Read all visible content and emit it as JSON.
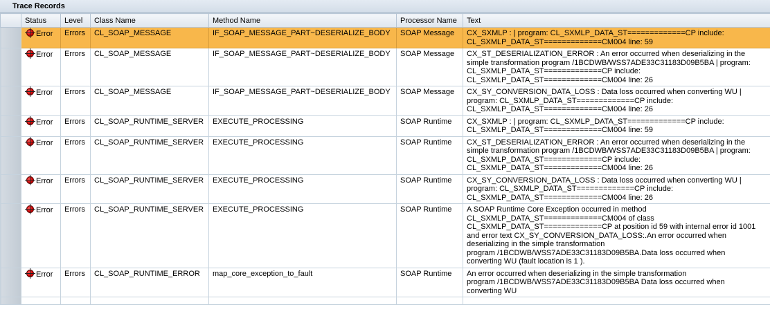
{
  "panel": {
    "title": "Trace Records"
  },
  "columns": {
    "status": "Status",
    "level": "Level",
    "class_name": "Class Name",
    "method_name": "Method Name",
    "processor_name": "Processor Name",
    "text": "Text"
  },
  "rows": [
    {
      "status": "Error",
      "level": "Errors",
      "class_name": "CL_SOAP_MESSAGE",
      "method_name": "IF_SOAP_MESSAGE_PART~DESERIALIZE_BODY",
      "processor_name": "SOAP Message",
      "text": "CX_SXMLP : | program: CL_SXMLP_DATA_ST=============CP include:\nCL_SXMLP_DATA_ST=============CM004 line: 59"
    },
    {
      "status": "Error",
      "level": "Errors",
      "class_name": "CL_SOAP_MESSAGE",
      "method_name": "IF_SOAP_MESSAGE_PART~DESERIALIZE_BODY",
      "processor_name": "SOAP Message",
      "text": "CX_ST_DESERIALIZATION_ERROR : An error occurred when deserializing in the\nsimple transformation program /1BCDWB/WSS7ADE33C31183D09B5BA | program:\nCL_SXMLP_DATA_ST=============CP include:\nCL_SXMLP_DATA_ST=============CM004 line: 26"
    },
    {
      "status": "Error",
      "level": "Errors",
      "class_name": "CL_SOAP_MESSAGE",
      "method_name": "IF_SOAP_MESSAGE_PART~DESERIALIZE_BODY",
      "processor_name": "SOAP Message",
      "text": "CX_SY_CONVERSION_DATA_LOSS : Data loss occurred when converting WU |\nprogram: CL_SXMLP_DATA_ST=============CP include:\nCL_SXMLP_DATA_ST=============CM004 line: 26"
    },
    {
      "status": "Error",
      "level": "Errors",
      "class_name": "CL_SOAP_RUNTIME_SERVER",
      "method_name": "EXECUTE_PROCESSING",
      "processor_name": "SOAP Runtime",
      "text": "CX_SXMLP : | program: CL_SXMLP_DATA_ST=============CP include:\nCL_SXMLP_DATA_ST=============CM004 line: 59"
    },
    {
      "status": "Error",
      "level": "Errors",
      "class_name": "CL_SOAP_RUNTIME_SERVER",
      "method_name": "EXECUTE_PROCESSING",
      "processor_name": "SOAP Runtime",
      "text": "CX_ST_DESERIALIZATION_ERROR : An error occurred when deserializing in the\nsimple transformation program /1BCDWB/WSS7ADE33C31183D09B5BA | program:\nCL_SXMLP_DATA_ST=============CP include:\nCL_SXMLP_DATA_ST=============CM004 line: 26"
    },
    {
      "status": "Error",
      "level": "Errors",
      "class_name": "CL_SOAP_RUNTIME_SERVER",
      "method_name": "EXECUTE_PROCESSING",
      "processor_name": "SOAP Runtime",
      "text": "CX_SY_CONVERSION_DATA_LOSS : Data loss occurred when converting WU |\nprogram: CL_SXMLP_DATA_ST=============CP include:\nCL_SXMLP_DATA_ST=============CM004 line: 26"
    },
    {
      "status": "Error",
      "level": "Errors",
      "class_name": "CL_SOAP_RUNTIME_SERVER",
      "method_name": "EXECUTE_PROCESSING",
      "processor_name": "SOAP Runtime",
      "text": "A SOAP Runtime Core Exception occurred in method\nCL_SXMLP_DATA_ST=============CM004 of class\nCL_SXMLP_DATA_ST=============CP at position id 59 with internal error id 1001\nand error text CX_SY_CONVERSION_DATA_LOSS:.An error occurred when\ndeserializing in the simple transformation\nprogram /1BCDWB/WSS7ADE33C31183D09B5BA.Data loss occurred when\nconverting WU (fault location is 1 )."
    },
    {
      "status": "Error",
      "level": "Errors",
      "class_name": "CL_SOAP_RUNTIME_ERROR",
      "method_name": "map_core_exception_to_fault",
      "processor_name": "SOAP Runtime",
      "text": "An error occurred when deserializing in the simple transformation\nprogram /1BCDWB/WSS7ADE33C31183D09B5BA Data loss occurred when\nconverting WU"
    }
  ],
  "colors": {
    "selected_row": "#f8b74b",
    "error_icon": "#d40000"
  },
  "icons": {
    "status": "error-icon"
  }
}
